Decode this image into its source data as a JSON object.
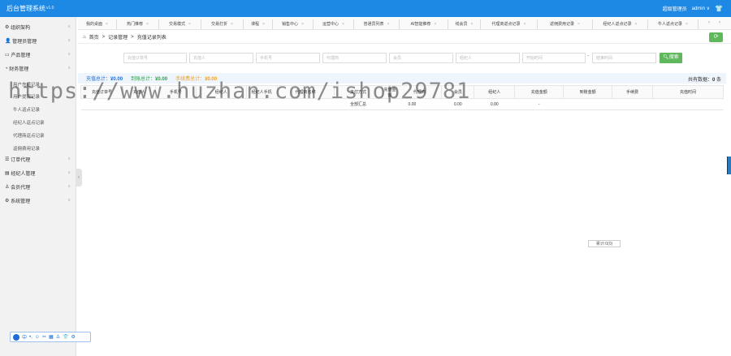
{
  "topbar": {
    "title": "后台管理系统",
    "version": "v1.0",
    "role": "超级管理员",
    "user": "admin",
    "user_chevron": "∨"
  },
  "sidebar": {
    "menus": [
      {
        "label": "组织架构"
      },
      {
        "label": "管理员管理"
      },
      {
        "label": "产品管理"
      },
      {
        "label": "财务管理"
      }
    ],
    "finance_items": [
      "用户充值记录",
      "用户提现记录",
      "牛人返点记录",
      "经纪人返点记录",
      "代理商返点记录",
      "返佣费用记录"
    ],
    "menus_after": [
      {
        "label": "订单代理"
      },
      {
        "label": "经纪人管理"
      },
      {
        "label": "会员代理"
      },
      {
        "label": "系统管理"
      }
    ]
  },
  "tabs": [
    "我的桌面",
    "热门推荐",
    "交易模式",
    "交易打折",
    "课程",
    "销售中心",
    "运营中心",
    "普通员列表",
    "AI智能推荐",
    "线会员",
    "代理商返点记录",
    "返佣费用记录",
    "经纪人返点记录",
    "牛人返点记录"
  ],
  "breadcrumb": {
    "home": "首页",
    "section": "记录管理",
    "page": "充值记录列表",
    "sep": ">"
  },
  "filters": [
    "充值订单号",
    "充值人",
    "手机号",
    "代理商",
    "会员",
    "经纪人",
    "开始时间",
    "结束时间"
  ],
  "filter_dash": "-",
  "search_label": "搜索",
  "summary": {
    "recharge_label": "充值总计：",
    "recharge_value": "¥0.00",
    "arrived_label": "到账总计：",
    "arrived_value": "¥0.00",
    "fee_label": "手续费总计：",
    "fee_value": "¥0.00",
    "total_label": "共有数据：",
    "total_value": "0",
    "total_unit": "条"
  },
  "table": {
    "headers": [
      "充值订单号",
      "充值人",
      "手机号",
      "经纪人",
      "经纪人手机",
      "代理商名称",
      "支付方式",
      "充值金额",
      "代理商",
      "会员",
      "经纪人",
      "充值金额",
      "到账金额",
      "手续费",
      "充值时间"
    ],
    "rows": [
      [
        "",
        "",
        "",
        "",
        "",
        "",
        "全部汇总",
        "0.00",
        "0.00",
        "0.00",
        "-",
        "",
        "",
        "",
        ""
      ]
    ]
  },
  "stats_badge": "累计:0(0)",
  "watermark": "https://www.huzhan.com/ishop29781",
  "colors": {
    "topbar": "#1e88e5",
    "accent_green": "#5fb85b",
    "summary_bg": "#eef5fd"
  }
}
